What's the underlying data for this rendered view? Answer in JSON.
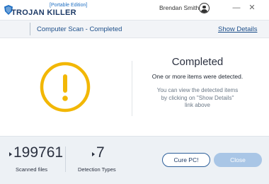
{
  "app": {
    "edition": "[Portable Edition]",
    "name": "TROJAN KILLER"
  },
  "user": {
    "name": "Brendan Smith"
  },
  "window_controls": {
    "minimize": "—",
    "close": "✕"
  },
  "header": {
    "title": "Computer Scan - Completed",
    "show_details": "Show Details"
  },
  "status": {
    "icon": "warning-icon",
    "title": "Completed",
    "subtitle": "One or more items were detected.",
    "description_lines": [
      "You can view the detected items",
      "by clicking on \"Show Details\"",
      "link above"
    ]
  },
  "stats": {
    "scanned_files": {
      "value": "199761",
      "label": "Scanned files"
    },
    "detection_types": {
      "value": "7",
      "label": "Detection Types"
    }
  },
  "buttons": {
    "cure": "Cure PC!",
    "close": "Close"
  },
  "colors": {
    "warning": "#f2b705",
    "brand": "#1d3a66",
    "link": "#1d4f8a",
    "close_button": "#a9c6e6"
  }
}
